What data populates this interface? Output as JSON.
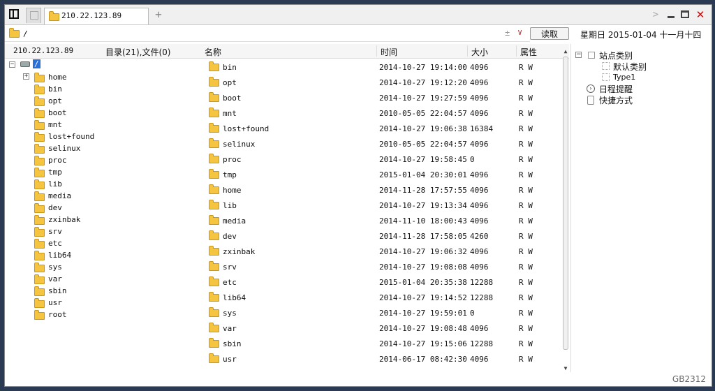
{
  "titlebar": {
    "tab_title": "210.22.123.89"
  },
  "pathbar": {
    "path": "/",
    "sort_glyph": "±",
    "dropdown_glyph": "∨",
    "read_label": "读取"
  },
  "datebar": {
    "weekday": "星期日",
    "date": "2015-01-04",
    "lunar": "十一月十四"
  },
  "tree_header": {
    "host": "210.22.123.89",
    "summary": "目录(21),文件(0)"
  },
  "columns": {
    "name": "名称",
    "time": "时间",
    "size": "大小",
    "attr": "属性"
  },
  "tree": {
    "root_label": "/",
    "nodes": [
      "home",
      "bin",
      "opt",
      "boot",
      "mnt",
      "lost+found",
      "selinux",
      "proc",
      "tmp",
      "lib",
      "media",
      "dev",
      "zxinbak",
      "srv",
      "etc",
      "lib64",
      "sys",
      "var",
      "sbin",
      "usr",
      "root"
    ]
  },
  "files": [
    {
      "name": "bin",
      "time": "2014-10-27 19:14:00",
      "size": "4096",
      "attr": "R W"
    },
    {
      "name": "opt",
      "time": "2014-10-27 19:12:20",
      "size": "4096",
      "attr": "R W"
    },
    {
      "name": "boot",
      "time": "2014-10-27 19:27:59",
      "size": "4096",
      "attr": "R W"
    },
    {
      "name": "mnt",
      "time": "2010-05-05 22:04:57",
      "size": "4096",
      "attr": "R W"
    },
    {
      "name": "lost+found",
      "time": "2014-10-27 19:06:38",
      "size": "16384",
      "attr": "R W"
    },
    {
      "name": "selinux",
      "time": "2010-05-05 22:04:57",
      "size": "4096",
      "attr": "R W"
    },
    {
      "name": "proc",
      "time": "2014-10-27 19:58:45",
      "size": "0",
      "attr": "R W"
    },
    {
      "name": "tmp",
      "time": "2015-01-04 20:30:01",
      "size": "4096",
      "attr": "R W"
    },
    {
      "name": "home",
      "time": "2014-11-28 17:57:55",
      "size": "4096",
      "attr": "R W"
    },
    {
      "name": "lib",
      "time": "2014-10-27 19:13:34",
      "size": "4096",
      "attr": "R W"
    },
    {
      "name": "media",
      "time": "2014-11-10 18:00:43",
      "size": "4096",
      "attr": "R W"
    },
    {
      "name": "dev",
      "time": "2014-11-28 17:58:05",
      "size": "4260",
      "attr": "R W"
    },
    {
      "name": "zxinbak",
      "time": "2014-10-27 19:06:32",
      "size": "4096",
      "attr": "R W"
    },
    {
      "name": "srv",
      "time": "2014-10-27 19:08:08",
      "size": "4096",
      "attr": "R W"
    },
    {
      "name": "etc",
      "time": "2015-01-04 20:35:38",
      "size": "12288",
      "attr": "R W"
    },
    {
      "name": "lib64",
      "time": "2014-10-27 19:14:52",
      "size": "12288",
      "attr": "R W"
    },
    {
      "name": "sys",
      "time": "2014-10-27 19:59:01",
      "size": "0",
      "attr": "R W"
    },
    {
      "name": "var",
      "time": "2014-10-27 19:08:48",
      "size": "4096",
      "attr": "R W"
    },
    {
      "name": "sbin",
      "time": "2014-10-27 19:15:06",
      "size": "12288",
      "attr": "R W"
    },
    {
      "name": "usr",
      "time": "2014-06-17 08:42:30",
      "size": "4096",
      "attr": "R W"
    }
  ],
  "rightpane": {
    "site_category": "站点类别",
    "default_category": "默认类别",
    "type1": "Type1",
    "schedule": "日程提醒",
    "shortcuts": "快捷方式"
  },
  "status": {
    "encoding": "GB2312"
  },
  "icons": {
    "sidebar_toggle": "sidebar-toggle-icon",
    "folder": "folder-icon",
    "hdd": "hard-drive-icon",
    "close": "close-icon",
    "minimize": "minimize-icon",
    "maximize": "maximize-icon"
  },
  "colors": {
    "selection": "#2b6fd8",
    "folder": "#f5c542",
    "close": "#dd0000"
  }
}
